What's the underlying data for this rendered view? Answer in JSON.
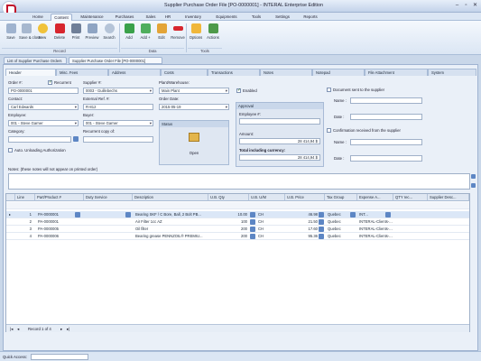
{
  "window": {
    "title": "Supplier Purchase Order File [PO-0000001] - INTERAL Enterprise Edition"
  },
  "menu": [
    "Home",
    "Content",
    "Maintenance",
    "Purchases",
    "Sales",
    "HR",
    "Inventory",
    "Equipments",
    "Tools",
    "Settings",
    "Reports"
  ],
  "ribbon": {
    "buttons": [
      "Save",
      "Save & close",
      "New",
      "Delete",
      "Print",
      "Preview",
      "Search",
      "Add",
      "Add +",
      "Edit",
      "Remove",
      "Options",
      "Actions"
    ],
    "groups": [
      "Record",
      "Data",
      "Tools"
    ]
  },
  "doc_tabs": [
    "List of Supplier Purchase Orders",
    "Supplier Purchase Order File [PO-0000001]"
  ],
  "form_tabs": [
    "Header",
    "Misc. Fees",
    "Address",
    "Costs",
    "Transactions",
    "Notes",
    "Notepad",
    "File Attachment",
    "System"
  ],
  "header": {
    "order_no_label": "Order #:",
    "recurrent_label": "Recurrent",
    "order_no": "PO-0000001",
    "supplier_label": "Supplier #:",
    "supplier": "0003 - Guillebechs",
    "plant_label": "Plant/Warehouse:",
    "plant": "Main Plant",
    "contact_label": "Contact:",
    "contact": "Carl Edwards",
    "extref_label": "External Ref. #:",
    "extref": "R-812",
    "order_date_label": "Order Date:",
    "order_date": "2015-05-19",
    "enabled_label": "Enabled",
    "employee_label": "Employee:",
    "employee": "001 - Steve Garner",
    "buyer_label": "Buyer:",
    "buyer": "001 - Steve Garner",
    "category_label": "Category:",
    "recurrent_copy_label": "Recurrent copy of:",
    "auto_unload_label": "Auto. Unloading Authorization",
    "status_label": "Status",
    "open_label": "Open",
    "approval_label": "Approval",
    "employee_no_label": "Employee #:",
    "amount_label": "Amount:",
    "amount": "28 414,94 $",
    "total_label": "Total including currency:",
    "total": "28 414,94 $",
    "doc_sent_label": "Document sent to the supplier",
    "name_label": "Name :",
    "date_label": "Date :",
    "confirmation_label": "Confirmation received from the supplier",
    "notes_label": "Notes: (these notes will not appear on printed order)"
  },
  "grid": {
    "columns": [
      "Line",
      "Part/Product #",
      "Duty Service",
      "Description",
      "U.B. Qty",
      "U.B. U/M",
      "U.B. Price",
      "Tax Group",
      "Expense A...",
      "QTY rec...",
      "Supplier Desc..."
    ],
    "rows": [
      {
        "line": "1",
        "part": "PA-0000001",
        "desc": "Bearing SKF / C Bore, Ball, 2 Bolt PB...",
        "qty": "10.00",
        "um": "CH",
        "price": "46.98",
        "tax": "Quebec",
        "exp": "INT..."
      },
      {
        "line": "2",
        "part": "PA-0000001",
        "desc": "Air Filter 1cc AZ",
        "qty": "100",
        "um": "CH",
        "price": "21.50",
        "tax": "Quebec",
        "exp": "INTERAL-Clients-..."
      },
      {
        "line": "3",
        "part": "PA-0000005",
        "desc": "Oil filter",
        "qty": "200",
        "um": "CH",
        "price": "17.60",
        "tax": "Quebec",
        "exp": "INTERAL-Clients-..."
      },
      {
        "line": "4",
        "part": "PA-0000006",
        "desc": "Bearing grease PENNZOIL® PREMIU...",
        "qty": "200",
        "um": "CH",
        "price": "95.36",
        "tax": "Quebec",
        "exp": "INTERAL-Clients-..."
      }
    ],
    "record_nav": "Record 1 of 4"
  },
  "status": {
    "quick_access_label": "Quick Access:"
  }
}
